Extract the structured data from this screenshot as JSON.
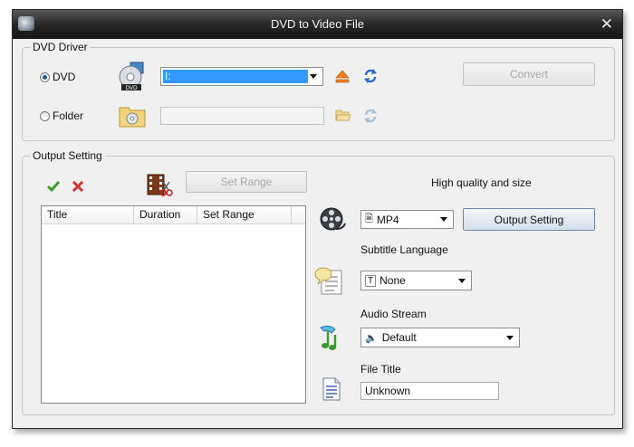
{
  "window": {
    "title": "DVD to Video File"
  },
  "dvd_driver": {
    "group_label": "DVD Driver",
    "dvd_radio_label": "DVD",
    "folder_radio_label": "Folder",
    "drive_value": "I:",
    "convert_label": "Convert"
  },
  "output": {
    "group_label": "Output Setting",
    "set_range_label": "Set Range",
    "table_columns": [
      "Title",
      "Duration",
      "Set Range"
    ],
    "quality_text": "High quality and size",
    "format_value": "MP4",
    "output_setting_label": "Output Setting",
    "subtitle_label": "Subtitle Language",
    "subtitle_value": "None",
    "audio_label": "Audio Stream",
    "audio_value": "Default",
    "file_title_label": "File Title",
    "file_title_value": "Unknown"
  },
  "colors": {
    "selection": "#3399ff",
    "check": "#3a9a2a",
    "cross": "#d03030"
  }
}
